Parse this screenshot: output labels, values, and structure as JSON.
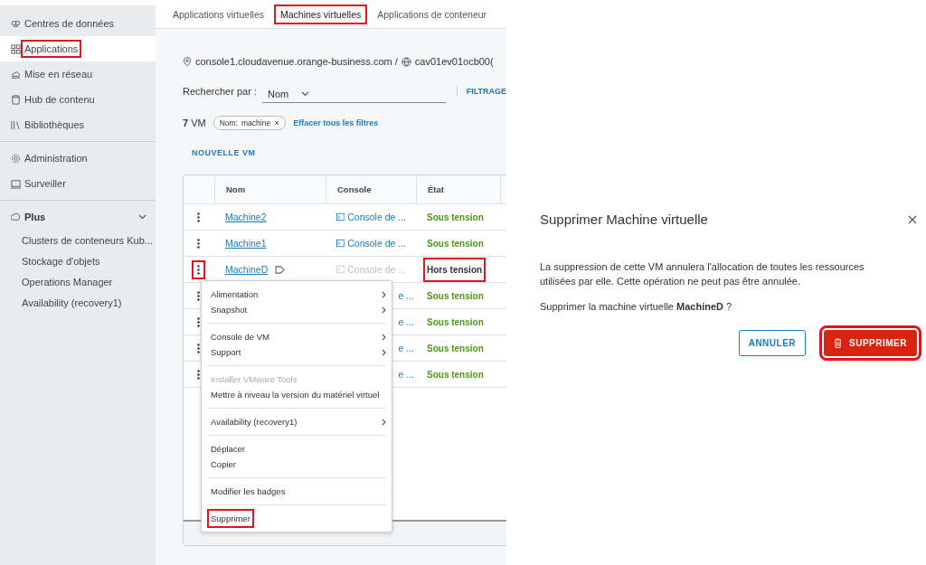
{
  "sidebar": {
    "groups": [
      {
        "items": [
          {
            "label": "Centres de données",
            "selected": false,
            "highlighted": false
          },
          {
            "label": "Applications",
            "selected": true,
            "highlighted": true
          },
          {
            "label": "Mise en réseau",
            "selected": false,
            "highlighted": false
          },
          {
            "label": "Hub de contenu",
            "selected": false,
            "highlighted": false
          },
          {
            "label": "Bibliothèques",
            "selected": false,
            "highlighted": false
          }
        ]
      },
      {
        "items": [
          {
            "label": "Administration",
            "selected": false,
            "highlighted": false
          },
          {
            "label": "Surveiller",
            "selected": false,
            "highlighted": false
          }
        ]
      }
    ],
    "more": {
      "label": "Plus",
      "expanded": true,
      "items": [
        "Clusters de conteneurs Kub...",
        "Stockage d'objets",
        "Operations Manager",
        "Availability (recovery1)"
      ]
    }
  },
  "tabs": [
    {
      "label": "Applications virtuelles",
      "selected": false,
      "highlighted": false
    },
    {
      "label": "Machines virtuelles",
      "selected": true,
      "highlighted": true
    },
    {
      "label": "Applications de conteneur",
      "selected": false,
      "highlighted": false
    }
  ],
  "breadcrumb": {
    "site": "console1.cloudavenue.orange-business.com /",
    "org": "cav01ev01ocb00("
  },
  "search": {
    "label": "Rechercher par :",
    "field": "Nom",
    "filter_button": "FILTRAGE"
  },
  "summary": {
    "count": "7",
    "unit": "VM",
    "chip_key": "Nom:",
    "chip_value": "machine",
    "clear": "Effacer tous les filtres"
  },
  "new_button": "NOUVELLE VM",
  "table": {
    "columns": [
      "Nom",
      "Console",
      "État"
    ],
    "rows": [
      {
        "kind": "full",
        "name": "Machine2",
        "console": "Console de ...",
        "console_enabled": true,
        "state": "Sous tension",
        "on": true,
        "badge": false,
        "kebab_highlighted": false,
        "state_highlighted": false
      },
      {
        "kind": "full",
        "name": "Machine1",
        "console": "Console de ...",
        "console_enabled": true,
        "state": "Sous tension",
        "on": true,
        "badge": false,
        "kebab_highlighted": false,
        "state_highlighted": false
      },
      {
        "kind": "full",
        "name": "MachineD",
        "console": "Console de ...",
        "console_enabled": false,
        "state": "Hors tension",
        "on": false,
        "badge": true,
        "kebab_highlighted": true,
        "state_highlighted": true
      },
      {
        "kind": "covered",
        "console": "e ...",
        "console_enabled": true,
        "state": "Sous tension",
        "on": true
      },
      {
        "kind": "covered",
        "console": "e ...",
        "console_enabled": true,
        "state": "Sous tension",
        "on": true
      },
      {
        "kind": "covered",
        "console": "e ...",
        "console_enabled": true,
        "state": "Sous tension",
        "on": true
      },
      {
        "kind": "covered",
        "console": "e ...",
        "console_enabled": true,
        "state": "Sous tension",
        "on": true
      }
    ]
  },
  "context_menu": {
    "sections": [
      {
        "items": [
          {
            "label": "Alimentation",
            "submenu": true,
            "disabled": false,
            "highlighted": false
          },
          {
            "label": "Snapshot",
            "submenu": true,
            "disabled": false,
            "highlighted": false
          }
        ]
      },
      {
        "items": [
          {
            "label": "Console de VM",
            "submenu": true,
            "disabled": false,
            "highlighted": false
          },
          {
            "label": "Support",
            "submenu": true,
            "disabled": false,
            "highlighted": false
          }
        ]
      },
      {
        "items": [
          {
            "label": "Installer VMware Tools",
            "submenu": false,
            "disabled": true,
            "highlighted": false
          },
          {
            "label": "Mettre à niveau la version du matériel virtuel",
            "submenu": false,
            "disabled": false,
            "highlighted": false
          }
        ]
      },
      {
        "items": [
          {
            "label": "Availability (recovery1)",
            "submenu": true,
            "disabled": false,
            "highlighted": false
          }
        ]
      },
      {
        "items": [
          {
            "label": "Déplacer",
            "submenu": false,
            "disabled": false,
            "highlighted": false
          },
          {
            "label": "Copier",
            "submenu": false,
            "disabled": false,
            "highlighted": false
          }
        ]
      },
      {
        "items": [
          {
            "label": "Modifier les badges",
            "submenu": false,
            "disabled": false,
            "highlighted": false
          }
        ]
      },
      {
        "items": [
          {
            "label": "Supprimer",
            "submenu": false,
            "disabled": false,
            "highlighted": true
          }
        ]
      }
    ]
  },
  "dialog": {
    "title": "Supprimer Machine virtuelle",
    "message": "La suppression de cette VM annulera l'allocation de toutes les ressources utilisées par elle. Cette opération ne peut pas être annulée.",
    "question": "Supprimer la machine virtuelle **MachineD** ?",
    "buttons": [
      {
        "kind": "secondary",
        "label": "ANNULER",
        "highlighted": false
      },
      {
        "kind": "danger",
        "label": "SUPPRIMER",
        "highlighted": true
      }
    ]
  }
}
